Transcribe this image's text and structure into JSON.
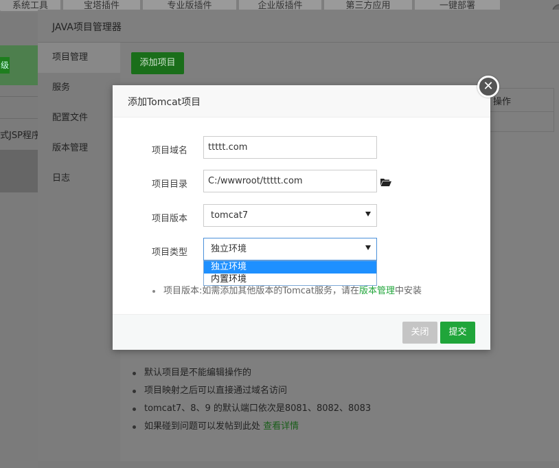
{
  "background": {
    "top_tabs": [
      "系统工具",
      "宝塔插件",
      "专业版插件",
      "企业版插件",
      "第三方应用",
      "一键部署"
    ],
    "left_button_label": "级",
    "left_text": "式JSP程序"
  },
  "java_manager": {
    "title": "JAVA项目管理器",
    "sidebar": [
      {
        "label": "项目管理",
        "active": true
      },
      {
        "label": "服务"
      },
      {
        "label": "配置文件"
      },
      {
        "label": "版本管理"
      },
      {
        "label": "日志"
      }
    ],
    "add_button": "添加项目",
    "table_header_op": "操作",
    "notes": [
      {
        "text": "默认项目是不能编辑操作的"
      },
      {
        "text": "项目映射之后可以直接通过域名访问"
      },
      {
        "text": "tomcat7、8、9 的默认端口依次是8081、8082、8083"
      },
      {
        "text": "如果碰到问题可以发帖到此处 ",
        "link": "查看详情"
      }
    ]
  },
  "modal": {
    "title": "添加Tomcat项目",
    "close_symbol": "✕",
    "fields": {
      "domain_label": "项目域名",
      "domain_value": "ttttt.com",
      "dir_label": "项目目录",
      "dir_value": "C:/wwwroot/ttttt.com",
      "version_label": "项目版本",
      "version_value": "tomcat7",
      "type_label": "项目类型",
      "type_value": "独立环境"
    },
    "type_options": [
      "独立环境",
      "内置环境"
    ],
    "hint_prefix": "项目版本:如需添加其他版本的Tomcat服务，请在",
    "hint_link": "版本管理",
    "hint_suffix": "中安装",
    "cancel_label": "关闭",
    "submit_label": "提交"
  },
  "colors": {
    "accent_green": "#20a53a",
    "select_highlight": "#1e90ff"
  }
}
